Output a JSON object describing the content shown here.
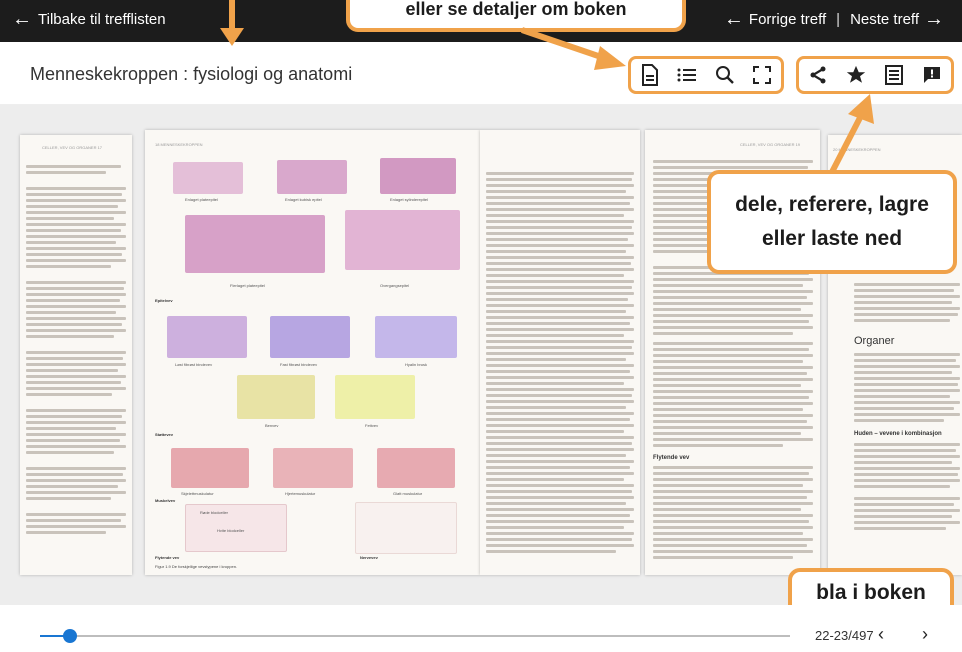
{
  "header": {
    "back_label": "Tilbake til trefflisten",
    "prev_label": "Forrige treff",
    "separator": "|",
    "next_label": "Neste treff"
  },
  "title": "Menneskekroppen : fysiologi og anatomi",
  "toolbar": {
    "view_icons": [
      "document-icon",
      "list-icon",
      "search-icon",
      "fullscreen-icon"
    ],
    "action_icons": [
      "share-icon",
      "star-icon",
      "cite-icon",
      "feedback-icon"
    ]
  },
  "book": {
    "left_page_header": "18  MENNESKEKROPPEN",
    "right_page_header": "CELLER, VEV OG ORGANER  19",
    "far_right_header": "20  MENNESKEKROPPEN",
    "far_left_header": "CELLER, VEV OG ORGANER  17",
    "section_heading": "Organer",
    "subheading": "Huden – vevene i kombinasjon",
    "subheading2": "Flytende vev",
    "diagram_labels": [
      "Enlaget plateepitel",
      "Enlaget kubisk epitel",
      "Enlaget sylinderepitel",
      "Flerlaget plateepitel",
      "Overgangsepitel",
      "Epitelvev",
      "Løst fibrøst bindevev",
      "Fast fibrøst bindevev",
      "Hyalin brusk",
      "Benvev",
      "Fettvev",
      "Støttevev",
      "Skjelettmuskulatur",
      "Hjertemuskulatur",
      "Glatt muskulatur",
      "Muskelvev",
      "Røde blodceller",
      "Hvite blodceller",
      "Flytende vev",
      "Nervevev"
    ],
    "figure_caption": "Figur 1.9 De forskjellige vevstypene i kroppen."
  },
  "callouts": {
    "top": "eller se detaljer om boken",
    "right": "dele, referere, lagre eller laste ned",
    "bottom": "bla i boken"
  },
  "pager": {
    "page_indicator": "22-23/497",
    "prev_icon": "chevron-left-icon",
    "next_icon": "chevron-right-icon",
    "progress_fraction": 0.04
  },
  "colors": {
    "header_bg": "#1c1c1c",
    "callout_border": "#f0a24a",
    "accent": "#1976d2"
  }
}
